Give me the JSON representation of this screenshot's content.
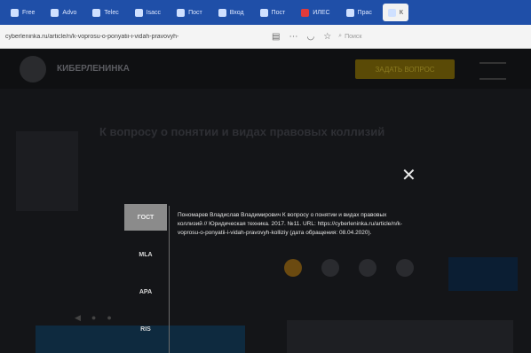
{
  "browser": {
    "tabs": [
      {
        "label": "Free"
      },
      {
        "label": "Advo"
      },
      {
        "label": "Telec"
      },
      {
        "label": "Isacc"
      },
      {
        "label": "Пост"
      },
      {
        "label": "Вход"
      },
      {
        "label": "Пост"
      },
      {
        "label": "ИЛЕС"
      },
      {
        "label": "Прас"
      },
      {
        "label": "К"
      }
    ],
    "url": "cyberleninka.ru/article/n/k-voprosu-o-ponyatii-i-vidah-pravovyh-",
    "search_placeholder": "Поиск"
  },
  "site": {
    "brand": "КИБЕРЛЕНИНКА",
    "cta_label": "ЗАДАТЬ ВОПРОС",
    "article_title": "К вопросу о понятии и видах правовых коллизий"
  },
  "cite_modal": {
    "close_label": "✕",
    "styles": [
      {
        "label": "ГОСТ",
        "active": true
      },
      {
        "label": "MLA",
        "active": false
      },
      {
        "label": "APA",
        "active": false
      },
      {
        "label": "RIS",
        "active": false
      }
    ],
    "citation_text": "Пономарев Владислав Владимирович К вопросу о понятии и видах правовых коллизий // Юридическая техника. 2017. №11. URL: https://cyberleninka.ru/article/n/k-voprosu-o-ponyatii-i-vidah-pravovyh-kolliziy (дата обращения: 08.04.2020)."
  }
}
